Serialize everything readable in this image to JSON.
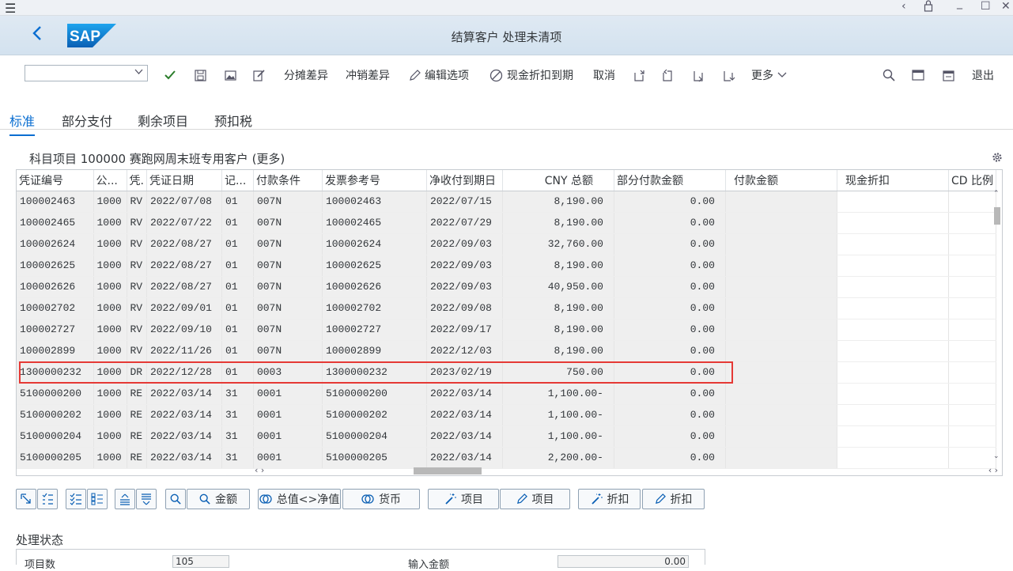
{
  "app": {
    "title": "结算客户 处理未清项",
    "logo": "SAP"
  },
  "toolbar": {
    "dropdown_value": "",
    "items": [
      "分摊差异",
      "冲销差异",
      "编辑选项",
      "现金折扣到期",
      "取消",
      "更多",
      "退出"
    ],
    "icons": [
      "check-icon",
      "save-icon",
      "image-icon",
      "edit-icon",
      "search-icon"
    ]
  },
  "tabs": [
    "标准",
    "部分支付",
    "剩余项目",
    "预扣税"
  ],
  "section": {
    "title": "科目项目 100000 赛跑网周末班专用客户 (更多)"
  },
  "grid": {
    "columns": [
      "凭证编号",
      "公...",
      "凭.",
      "凭证日期",
      "记...",
      "付款条件",
      "发票参考号",
      "净收付到期日",
      "CNY 总额",
      "部分付款金额",
      "付款金额",
      "现金折扣",
      "CD 比例"
    ],
    "rows": [
      [
        "100002463",
        "1000",
        "RV",
        "2022/07/08",
        "01",
        "007N",
        "100002463",
        "2022/07/15",
        "8,190.00",
        "0.00"
      ],
      [
        "100002465",
        "1000",
        "RV",
        "2022/07/22",
        "01",
        "007N",
        "100002465",
        "2022/07/29",
        "8,190.00",
        "0.00"
      ],
      [
        "100002624",
        "1000",
        "RV",
        "2022/08/27",
        "01",
        "007N",
        "100002624",
        "2022/09/03",
        "32,760.00",
        "0.00"
      ],
      [
        "100002625",
        "1000",
        "RV",
        "2022/08/27",
        "01",
        "007N",
        "100002625",
        "2022/09/03",
        "8,190.00",
        "0.00"
      ],
      [
        "100002626",
        "1000",
        "RV",
        "2022/08/27",
        "01",
        "007N",
        "100002626",
        "2022/09/03",
        "40,950.00",
        "0.00"
      ],
      [
        "100002702",
        "1000",
        "RV",
        "2022/09/01",
        "01",
        "007N",
        "100002702",
        "2022/09/08",
        "8,190.00",
        "0.00"
      ],
      [
        "100002727",
        "1000",
        "RV",
        "2022/09/10",
        "01",
        "007N",
        "100002727",
        "2022/09/17",
        "8,190.00",
        "0.00"
      ],
      [
        "100002899",
        "1000",
        "RV",
        "2022/11/26",
        "01",
        "007N",
        "100002899",
        "2022/12/03",
        "8,190.00",
        "0.00"
      ],
      [
        "1300000232",
        "1000",
        "DR",
        "2022/12/28",
        "01",
        "0003",
        "1300000232",
        "2023/02/19",
        "750.00",
        "0.00"
      ],
      [
        "5100000200",
        "1000",
        "RE",
        "2022/03/14",
        "31",
        "0001",
        "5100000200",
        "2022/03/14",
        "1,100.00-",
        "0.00"
      ],
      [
        "5100000202",
        "1000",
        "RE",
        "2022/03/14",
        "31",
        "0001",
        "5100000202",
        "2022/03/14",
        "1,100.00-",
        "0.00"
      ],
      [
        "5100000204",
        "1000",
        "RE",
        "2022/03/14",
        "31",
        "0001",
        "5100000204",
        "2022/03/14",
        "1,100.00-",
        "0.00"
      ],
      [
        "5100000205",
        "1000",
        "RE",
        "2022/03/14",
        "31",
        "0001",
        "5100000205",
        "2022/03/14",
        "2,200.00-",
        "0.00"
      ]
    ]
  },
  "buttons": [
    "金额",
    "总值<>净值",
    "货币",
    "项目",
    "项目",
    "折扣",
    "折扣"
  ],
  "status": {
    "title": "处理状态",
    "labels": [
      "项目数",
      "输入金额"
    ],
    "values": [
      "105",
      "0.00"
    ]
  }
}
